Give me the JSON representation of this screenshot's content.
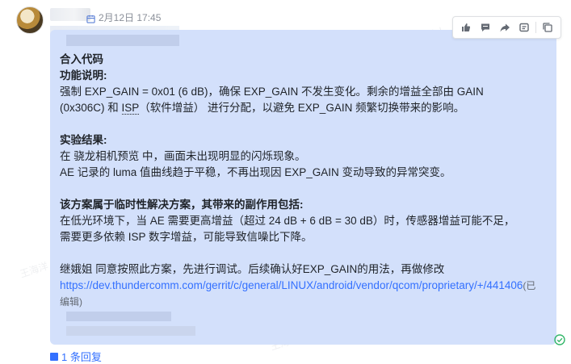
{
  "header": {
    "timestamp": "2月12日 17:45"
  },
  "toolbar": {
    "buttons": [
      "like-icon",
      "comment-icon",
      "forward-icon",
      "more-icon",
      "copy-icon"
    ]
  },
  "message": {
    "title": "合入代码",
    "section1_heading": "功能说明:",
    "section1_body_a": "强制 EXP_GAIN = 0x01 (6 dB)，确保 EXP_GAIN 不发生变化。剩余的增益全部由 GAIN",
    "section1_body_b_pre": "(0x306C) 和 ",
    "section1_body_b_isp": "ISP",
    "section1_body_b_post": "（软件增益） 进行分配，以避免 EXP_GAIN 频繁切换带来的影响。",
    "section2_heading": "实验结果:",
    "section2_line1": "在 骁龙相机预览 中，画面未出现明显的闪烁现象。",
    "section2_line2": "AE 记录的 luma 值曲线趋于平稳，不再出现因 EXP_GAIN 变动导致的异常突变。",
    "section3_heading": "该方案属于临时性解决方案，其带来的副作用包括:",
    "section3_line1": "在低光环境下，当 AE 需要更高增益（超过 24 dB + 6 dB = 30 dB）时，传感器增益可能不足，",
    "section3_line2": "需要更多依赖 ISP 数字增益，可能导致信噪比下降。",
    "closing": "继娥姐 同意按照此方案，先进行调试。后续确认好EXP_GAIN的用法，再做修改",
    "link": "https://dev.thundercomm.com/gerrit/c/general/LINUX/android/vendor/qcom/proprietary/+/441406",
    "edited": "(已编辑)"
  },
  "footer": {
    "reply_count": "1 条回复"
  },
  "watermark": "王海洋 3057 ThunderSoft Confidential",
  "colors": {
    "bubble": "#d3e0fb",
    "link": "#3370ff"
  }
}
